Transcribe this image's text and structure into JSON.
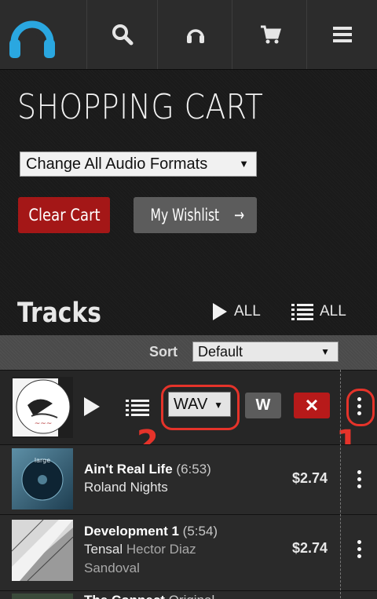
{
  "nav": {
    "logo_icon": "headphones-logo-icon",
    "items": [
      {
        "icon": "search-icon"
      },
      {
        "icon": "headphones-icon"
      },
      {
        "icon": "cart-icon"
      },
      {
        "icon": "menu-icon"
      }
    ]
  },
  "page": {
    "title": "SHOPPING CART",
    "format_select": "Change All Audio Formats",
    "clear_cart": "Clear Cart",
    "wishlist": "My Wishlist",
    "wishlist_arrow": "→"
  },
  "tracks_header": {
    "title": "Tracks",
    "play_all": "ALL",
    "queue_all": "ALL"
  },
  "sort": {
    "label": "Sort",
    "value": "Default"
  },
  "first_row": {
    "format": "WAV",
    "w_label": "W",
    "remove_label": "✕",
    "annotation_1": "1",
    "annotation_2": "2"
  },
  "tracks": [
    {
      "title": "Ain't Real Life",
      "duration": "(6:53)",
      "artist": "Roland Nights",
      "remixer": "",
      "price": "$2.74"
    },
    {
      "title": "Development 1",
      "duration": "(5:54)",
      "artist": "Tensal",
      "remixer": "Hector Diaz Sandoval",
      "price": "$2.74"
    },
    {
      "title": "The Connect",
      "duration": "Original",
      "artist": "",
      "remixer": "",
      "price": ""
    }
  ],
  "colors": {
    "accent_blue": "#2aa7e0",
    "red": "#a41717",
    "annotation_red": "#e5332a"
  }
}
